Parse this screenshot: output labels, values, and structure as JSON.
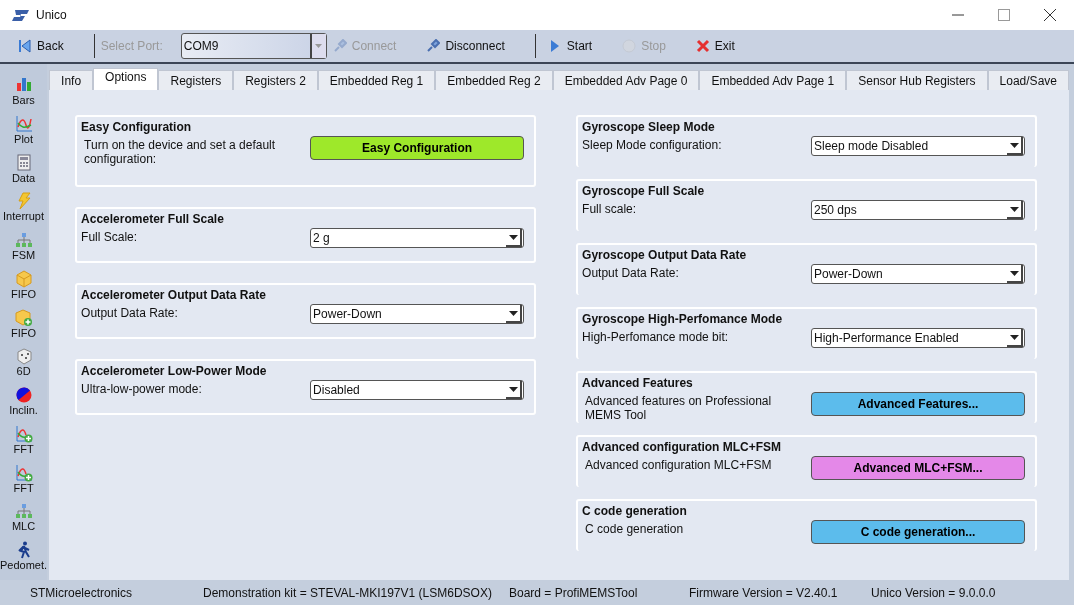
{
  "window": {
    "title": "Unico"
  },
  "toolbar": [
    {
      "kind": "back",
      "label": "Back",
      "disabled": false
    },
    {
      "kind": "separator"
    },
    {
      "kind": "label",
      "label": "Select Port:",
      "disabled": true
    },
    {
      "kind": "combo",
      "value": "COM9"
    },
    {
      "kind": "connect",
      "label": "Connect",
      "disabled": true
    },
    {
      "kind": "disconnect",
      "label": "Disconnect",
      "disabled": false
    },
    {
      "kind": "separator"
    },
    {
      "kind": "start",
      "label": "Start",
      "disabled": false
    },
    {
      "kind": "stop",
      "label": "Stop",
      "disabled": true
    },
    {
      "kind": "exit",
      "label": "Exit",
      "disabled": false
    }
  ],
  "sidebar": {
    "items": [
      {
        "kind": "bars",
        "label": "Bars"
      },
      {
        "kind": "plot",
        "label": "Plot"
      },
      {
        "kind": "data",
        "label": "Data"
      },
      {
        "kind": "interrupt",
        "label": "Interrupt"
      },
      {
        "kind": "tree",
        "label": "FSM"
      },
      {
        "kind": "box",
        "label": "FIFO"
      },
      {
        "kind": "boxplus",
        "label": "FIFO"
      },
      {
        "kind": "dice",
        "label": "6D"
      },
      {
        "kind": "ball",
        "label": "Inclin."
      },
      {
        "kind": "plotplus",
        "label": "FFT"
      },
      {
        "kind": "plotplus",
        "label": "FFT"
      },
      {
        "kind": "tree",
        "label": "MLC"
      },
      {
        "kind": "walker",
        "label": "Pedomet."
      }
    ]
  },
  "tabs": [
    {
      "label": "Info",
      "selected": false
    },
    {
      "label": "Options",
      "selected": true
    },
    {
      "label": "Registers",
      "selected": false
    },
    {
      "label": "Registers 2",
      "selected": false
    },
    {
      "label": "Embedded Reg 1",
      "selected": false
    },
    {
      "label": "Embedded Reg 2",
      "selected": false
    },
    {
      "label": "Embedded Adv Page 0",
      "selected": false
    },
    {
      "label": "Embedded Adv Page 1",
      "selected": false
    },
    {
      "label": "Sensor Hub Registers",
      "selected": false
    },
    {
      "label": "Load/Save",
      "selected": false
    }
  ],
  "left_panels": [
    {
      "kind": "button",
      "title": "Easy Configuration",
      "label": "Turn on the device and set a default configuration:",
      "button": "Easy Configuration",
      "color": "#9ee82a"
    },
    {
      "kind": "select",
      "title": "Accelerometer Full Scale",
      "label": "Full Scale:",
      "value": "2 g"
    },
    {
      "kind": "select",
      "title": "Accelerometer Output Data Rate",
      "label": "Output Data Rate:",
      "value": "Power-Down"
    },
    {
      "kind": "select",
      "title": "Accelerometer Low-Power Mode",
      "label": "Ultra-low-power mode:",
      "value": "Disabled"
    }
  ],
  "right_panels": [
    {
      "kind": "select",
      "title": "Gyroscope Sleep Mode",
      "label": "Sleep Mode configuration:",
      "value": "Sleep mode Disabled"
    },
    {
      "kind": "select",
      "title": "Gyroscope Full Scale",
      "label": "Full scale:",
      "value": "250 dps"
    },
    {
      "kind": "select",
      "title": "Gyroscope Output Data Rate",
      "label": "Output Data Rate:",
      "value": "Power-Down"
    },
    {
      "kind": "select",
      "title": "Gyroscope High-Perfomance Mode",
      "label": "High-Perfomance mode bit:",
      "value": "High-Performance Enabled"
    },
    {
      "kind": "button",
      "title": "Advanced Features",
      "label": "Advanced features on Professional MEMS Tool",
      "button": "Advanced Features...",
      "color": "#5cbcec"
    },
    {
      "kind": "button",
      "title": "Advanced configuration MLC+FSM",
      "label": "Advanced configuration MLC+FSM",
      "button": "Advanced MLC+FSM...",
      "color": "#e488e8"
    },
    {
      "kind": "button",
      "title": "C code generation",
      "label": "C code generation",
      "button": "C code generation...",
      "color": "#5cbcec"
    }
  ],
  "status_bar": [
    "STMicroelectronics",
    "Demonstration kit = STEVAL-MKI197V1 (LSM6DSOX)",
    "Board = ProfiMEMSTool",
    "Firmware Version = V2.40.1",
    "Unico Version = 9.0.0.0"
  ]
}
